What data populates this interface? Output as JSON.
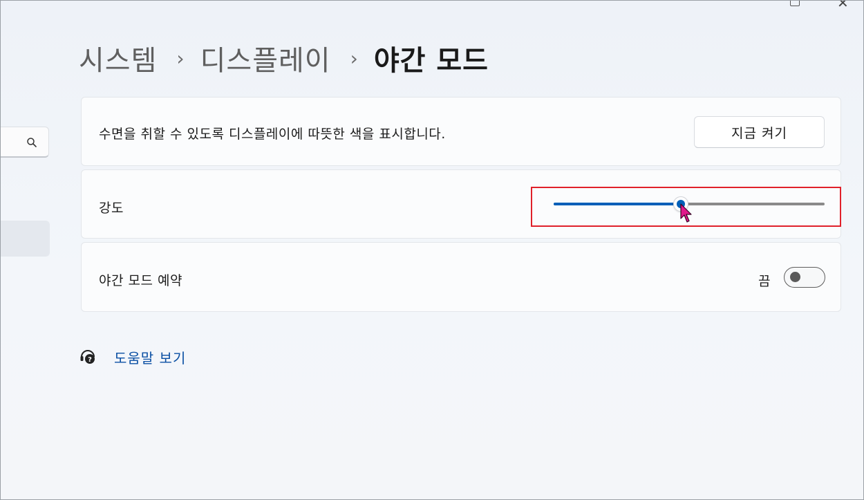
{
  "breadcrumb": {
    "items": [
      "시스템",
      "디스플레이",
      "야간 모드"
    ],
    "separator": "›"
  },
  "description_card": {
    "text": "수면을 취할 수 있도록 디스플레이에 따뜻한 색을 표시합니다.",
    "button_label": "지금 켜기"
  },
  "strength_card": {
    "label": "강도",
    "slider_value_fraction": 0.47,
    "accent_color": "#005fb8",
    "highlight_color": "#e0202a"
  },
  "schedule_card": {
    "label": "야간 모드 예약",
    "toggle_state_label": "끔",
    "toggle_on": false
  },
  "help": {
    "link_text": "도움말 보기",
    "icon": "help-headset-icon"
  },
  "sidebar": {
    "search_icon": "search-icon"
  }
}
